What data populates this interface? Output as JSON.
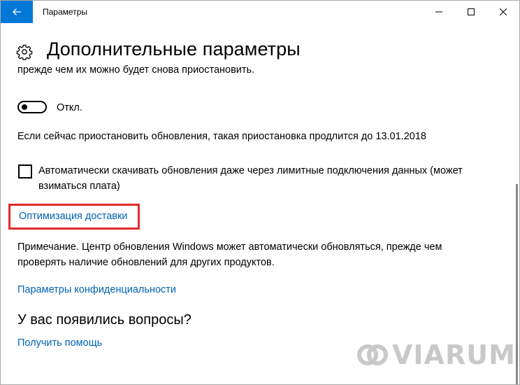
{
  "window": {
    "title": "Параметры",
    "back_icon": "arrow-left-icon",
    "minimize_icon": "minimize-icon",
    "maximize_icon": "maximize-icon",
    "close_icon": "close-icon",
    "accent_color": "#0078d7"
  },
  "header": {
    "icon": "gear-icon",
    "title": "Дополнительные параметры"
  },
  "content": {
    "cut_text": "прежде чем их можно будет снова приостановить.",
    "pause_toggle": {
      "label": "Откл.",
      "state": "off"
    },
    "pause_info": "Если сейчас приостановить обновления, такая приостановка продлится до 13.01.2018",
    "metered_checkbox": {
      "checked": false,
      "label": "Автоматически скачивать обновления даже через лимитные подключения данных (может взиматься плата)"
    },
    "delivery_link": "Оптимизация доставки",
    "highlight_color": "#e32b2b",
    "note": "Примечание. Центр обновления Windows может автоматически обновляться, прежде чем проверять наличие обновлений для других продуктов.",
    "privacy_link": "Параметры конфиденциальности",
    "questions_title": "У вас появились вопросы?",
    "help_link": "Получить помощь",
    "link_color": "#0063b1"
  },
  "watermark": {
    "text": "VIARUM",
    "logo_icon": "viarum-logo-icon"
  }
}
